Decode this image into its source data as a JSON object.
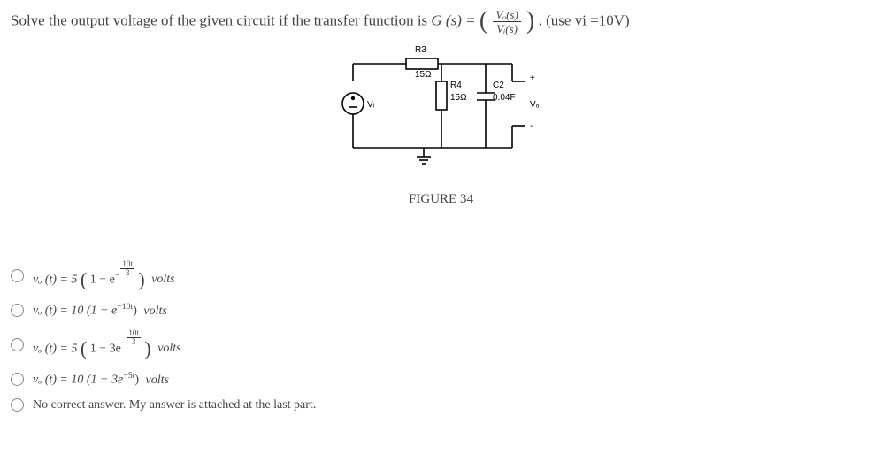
{
  "question": {
    "prefix": "Solve the output voltage of the given circuit if the transfer function is ",
    "gs": "G (s) = ",
    "frac_num": "Vₒ(s)",
    "frac_den": "Vᵢ(s)",
    "suffix": ". (use vi =10V)"
  },
  "circuit": {
    "r3_label": "R3",
    "r3_value": "15Ω",
    "vi_label": "Vᵢ",
    "r4_label": "R4",
    "r4_value": "15Ω",
    "c2_label": "C2",
    "c2_value": "0.04F",
    "vo_plus": "+",
    "vo_label": "Vₒ",
    "vo_minus": "-"
  },
  "figure_caption": "FIGURE 34",
  "options": [
    {
      "pre": "vₒ (t) = 5 ",
      "lp": "(",
      "mid": "1 − e",
      "exp_num": "10t",
      "exp_den": "3",
      "exp_neg": "−",
      "rp": ")",
      "post": " volts"
    },
    {
      "pre": "vₒ (t) = 10 (1 − e",
      "plain_exp": "−10t",
      "rp": ")",
      "post": " volts"
    },
    {
      "pre": "vₒ (t) = 5 ",
      "lp": "(",
      "mid": "1 − 3e",
      "exp_num": "10t",
      "exp_den": "3",
      "exp_neg": "−",
      "rp": ")",
      "post": " volts"
    },
    {
      "pre": "vₒ (t) = 10 (1 − 3e",
      "plain_exp": "−5t",
      "rp": ")",
      "post": " volts"
    },
    {
      "text": "No correct answer. My answer is attached at the last part."
    }
  ]
}
